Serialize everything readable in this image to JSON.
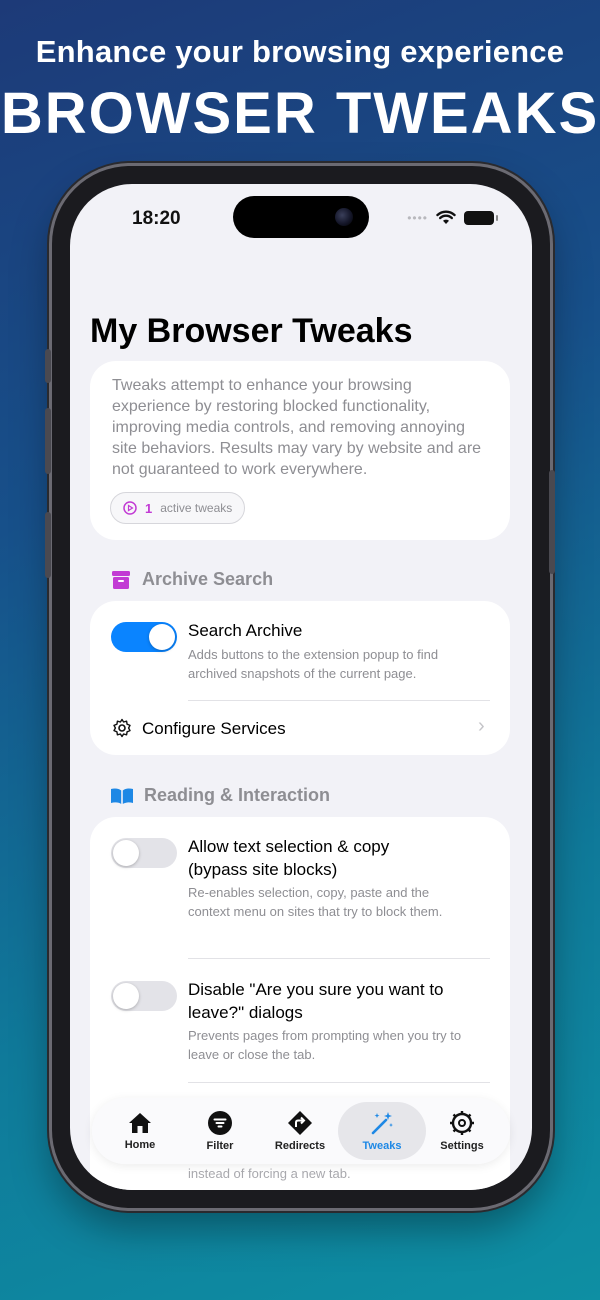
{
  "promo": {
    "headline": "Enhance your browsing experience",
    "hero_title": "BROWSER TWEAKS"
  },
  "status_bar": {
    "time": "18:20"
  },
  "page": {
    "title": "My Browser Tweaks",
    "intro": "Tweaks attempt to enhance your browsing experience by restoring blocked functionality, improving media controls, and removing annoying site behaviors. Results may vary by website and are not guaranteed to work everywhere.",
    "active_count": "1",
    "active_label": "active tweaks"
  },
  "sections": {
    "archive": {
      "title": "Archive Search",
      "icon": "archive-box-icon",
      "search_archive": {
        "title": "Search Archive",
        "description": "Adds buttons to the extension popup to find archived snapshots of the current page.",
        "enabled": true
      },
      "configure": {
        "label": "Configure Services",
        "icon": "gear-icon"
      }
    },
    "reading": {
      "title": "Reading & Interaction",
      "icon": "book-icon",
      "items": [
        {
          "title": "Allow text selection & copy (bypass site blocks)",
          "description": "Re-enables selection, copy, paste and the context menu on sites that try to block them.",
          "enabled": false
        },
        {
          "title": "Disable \"Are you sure you want to leave?\" dialogs",
          "description": "Prevents pages from prompting when you try to leave or close the tab.",
          "enabled": false
        }
      ],
      "partial_text": "instead of forcing a new tab."
    }
  },
  "tabbar": {
    "tabs": [
      {
        "label": "Home",
        "icon": "house-icon"
      },
      {
        "label": "Filter",
        "icon": "filter-icon"
      },
      {
        "label": "Redirects",
        "icon": "redirect-arrow-icon"
      },
      {
        "label": "Tweaks",
        "icon": "magic-wand-icon",
        "active": true
      },
      {
        "label": "Settings",
        "icon": "gear-icon"
      }
    ]
  },
  "colors": {
    "accent": "#0a84ff",
    "archive_icon": "#c23bd4",
    "reading_icon": "#1e88e5",
    "active_tab": "#1e88e5"
  }
}
